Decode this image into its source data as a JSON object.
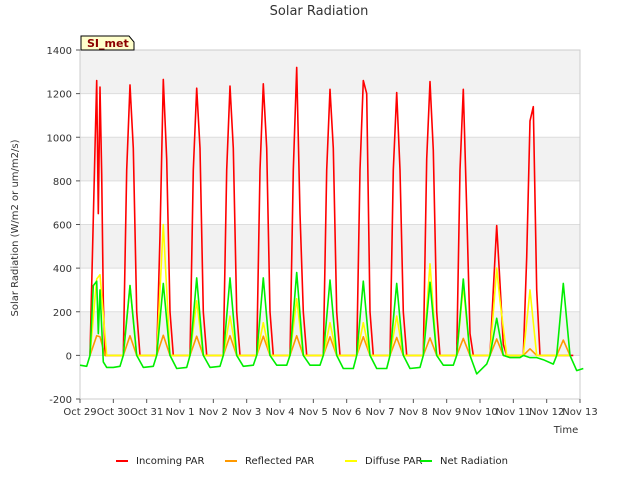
{
  "chart_data": {
    "type": "line",
    "title": "Solar Radiation",
    "xlabel": "Time",
    "ylabel": "Solar Radiation (W/m2 or um/m2/s)",
    "site_label": "SI_met",
    "xlim": [
      0,
      15
    ],
    "ylim": [
      -200,
      1400
    ],
    "x_tick_labels": [
      "Oct 29",
      "Oct 30",
      "Oct 31",
      "Nov 1",
      "Nov 2",
      "Nov 3",
      "Nov 4",
      "Nov 5",
      "Nov 6",
      "Nov 7",
      "Nov 8",
      "Nov 9",
      "Nov 10",
      "Nov 11",
      "Nov 12",
      "Nov 13"
    ],
    "y_ticks": [
      -200,
      0,
      200,
      400,
      600,
      800,
      1000,
      1200,
      1400
    ],
    "x_unit": "days since Oct 29",
    "grid": true,
    "legend_position": "bottom",
    "series": [
      {
        "name": "Incoming PAR",
        "color": "#ff0000",
        "x": [
          0.3,
          0.45,
          0.5,
          0.55,
          0.6,
          0.65,
          0.7,
          0.75,
          0.8,
          1.3,
          1.4,
          1.5,
          1.6,
          1.7,
          1.8,
          2.3,
          2.4,
          2.5,
          2.6,
          2.7,
          2.8,
          3.3,
          3.4,
          3.5,
          3.6,
          3.7,
          3.8,
          4.3,
          4.4,
          4.5,
          4.6,
          4.7,
          4.8,
          5.3,
          5.4,
          5.5,
          5.6,
          5.7,
          5.8,
          6.3,
          6.4,
          6.5,
          6.6,
          6.7,
          6.8,
          7.3,
          7.4,
          7.5,
          7.6,
          7.7,
          7.8,
          8.3,
          8.4,
          8.5,
          8.6,
          8.7,
          8.8,
          9.3,
          9.4,
          9.5,
          9.6,
          9.7,
          9.8,
          10.3,
          10.4,
          10.5,
          10.6,
          10.7,
          10.8,
          11.3,
          11.4,
          11.5,
          11.6,
          11.7,
          11.8,
          12.3,
          12.4,
          12.5,
          12.6,
          12.7,
          12.8,
          13.3,
          13.4,
          13.5,
          13.6,
          13.7,
          13.8,
          14.3,
          14.4,
          14.5,
          14.6,
          14.7,
          14.8
        ],
        "y": [
          0,
          950,
          1260,
          650,
          1230,
          830,
          250,
          0,
          0,
          0,
          850,
          1240,
          950,
          200,
          0,
          0,
          550,
          1265,
          900,
          200,
          0,
          0,
          850,
          1225,
          950,
          200,
          0,
          0,
          850,
          1235,
          950,
          200,
          0,
          0,
          850,
          1245,
          950,
          200,
          0,
          0,
          850,
          1320,
          650,
          200,
          0,
          0,
          850,
          1220,
          950,
          200,
          0,
          0,
          850,
          1260,
          1200,
          200,
          0,
          0,
          850,
          1205,
          850,
          200,
          0,
          0,
          900,
          1255,
          940,
          200,
          0,
          0,
          850,
          1220,
          670,
          100,
          0,
          0,
          300,
          595,
          330,
          50,
          0,
          0,
          450,
          1075,
          1140,
          300,
          0,
          0,
          0,
          0,
          0,
          0,
          0
        ]
      },
      {
        "name": "Reflected PAR",
        "color": "#ff9900",
        "x": [
          0.3,
          0.5,
          0.6,
          0.75,
          1.3,
          1.5,
          1.7,
          2.3,
          2.5,
          2.7,
          3.3,
          3.5,
          3.7,
          4.3,
          4.5,
          4.7,
          5.3,
          5.5,
          5.7,
          6.3,
          6.5,
          6.7,
          7.3,
          7.5,
          7.7,
          8.3,
          8.5,
          8.7,
          9.3,
          9.5,
          9.7,
          10.3,
          10.5,
          10.7,
          11.3,
          11.5,
          11.7,
          12.3,
          12.5,
          12.7,
          13.3,
          13.5,
          13.7,
          14.3,
          14.5,
          14.7
        ],
        "y": [
          0,
          90,
          85,
          0,
          0,
          90,
          0,
          0,
          92,
          0,
          0,
          88,
          0,
          0,
          90,
          0,
          0,
          88,
          0,
          0,
          90,
          0,
          0,
          85,
          0,
          0,
          85,
          0,
          0,
          82,
          0,
          0,
          80,
          0,
          0,
          78,
          0,
          0,
          75,
          0,
          0,
          30,
          0,
          0,
          70,
          0
        ]
      },
      {
        "name": "Diffuse PAR",
        "color": "#ffff00",
        "x": [
          0.3,
          0.5,
          0.6,
          0.8,
          1.3,
          1.5,
          1.7,
          2.3,
          2.5,
          2.6,
          2.7,
          3.3,
          3.5,
          3.7,
          4.3,
          4.5,
          4.7,
          5.3,
          5.5,
          5.7,
          6.3,
          6.5,
          6.7,
          7.3,
          7.5,
          7.7,
          8.3,
          8.5,
          8.7,
          9.3,
          9.5,
          9.7,
          10.3,
          10.5,
          10.7,
          11.3,
          11.5,
          11.7,
          12.3,
          12.5,
          12.6,
          12.8,
          13.3,
          13.5,
          13.7,
          14.3,
          14.5,
          14.7
        ],
        "y": [
          0,
          350,
          370,
          0,
          0,
          320,
          0,
          0,
          600,
          300,
          0,
          0,
          250,
          0,
          0,
          180,
          0,
          0,
          150,
          0,
          0,
          260,
          0,
          0,
          150,
          0,
          0,
          150,
          0,
          0,
          180,
          0,
          0,
          420,
          0,
          0,
          320,
          0,
          0,
          400,
          250,
          0,
          0,
          300,
          0,
          0,
          0,
          0
        ]
      },
      {
        "name": "Net Radiation",
        "color": "#00ee00",
        "x": [
          0.0,
          0.2,
          0.3,
          0.4,
          0.5,
          0.55,
          0.6,
          0.7,
          0.8,
          1.0,
          1.2,
          1.3,
          1.5,
          1.7,
          1.9,
          2.2,
          2.3,
          2.5,
          2.7,
          2.9,
          3.2,
          3.3,
          3.5,
          3.7,
          3.9,
          4.2,
          4.3,
          4.5,
          4.7,
          4.9,
          5.2,
          5.3,
          5.5,
          5.7,
          5.9,
          6.2,
          6.3,
          6.5,
          6.7,
          6.9,
          7.2,
          7.3,
          7.5,
          7.7,
          7.9,
          8.2,
          8.3,
          8.5,
          8.7,
          8.9,
          9.2,
          9.3,
          9.5,
          9.7,
          9.9,
          10.2,
          10.3,
          10.5,
          10.7,
          10.9,
          11.2,
          11.3,
          11.5,
          11.7,
          11.9,
          12.2,
          12.3,
          12.5,
          12.7,
          12.9,
          13.2,
          13.3,
          13.5,
          13.7,
          13.9,
          14.2,
          14.3,
          14.5,
          14.7,
          14.9,
          15.1
        ],
        "y": [
          -45,
          -50,
          0,
          320,
          340,
          100,
          300,
          -30,
          -55,
          -55,
          -50,
          0,
          320,
          0,
          -55,
          -50,
          0,
          330,
          0,
          -60,
          -55,
          0,
          355,
          0,
          -55,
          -50,
          0,
          355,
          0,
          -50,
          -45,
          0,
          355,
          0,
          -45,
          -45,
          0,
          380,
          0,
          -45,
          -45,
          0,
          345,
          0,
          -60,
          -60,
          0,
          340,
          0,
          -60,
          -60,
          0,
          330,
          0,
          -60,
          -55,
          0,
          335,
          0,
          -45,
          -45,
          0,
          350,
          0,
          -85,
          -40,
          0,
          170,
          0,
          -10,
          -10,
          0,
          -10,
          -10,
          -20,
          -40,
          0,
          330,
          0,
          -70,
          -60
        ]
      }
    ]
  }
}
